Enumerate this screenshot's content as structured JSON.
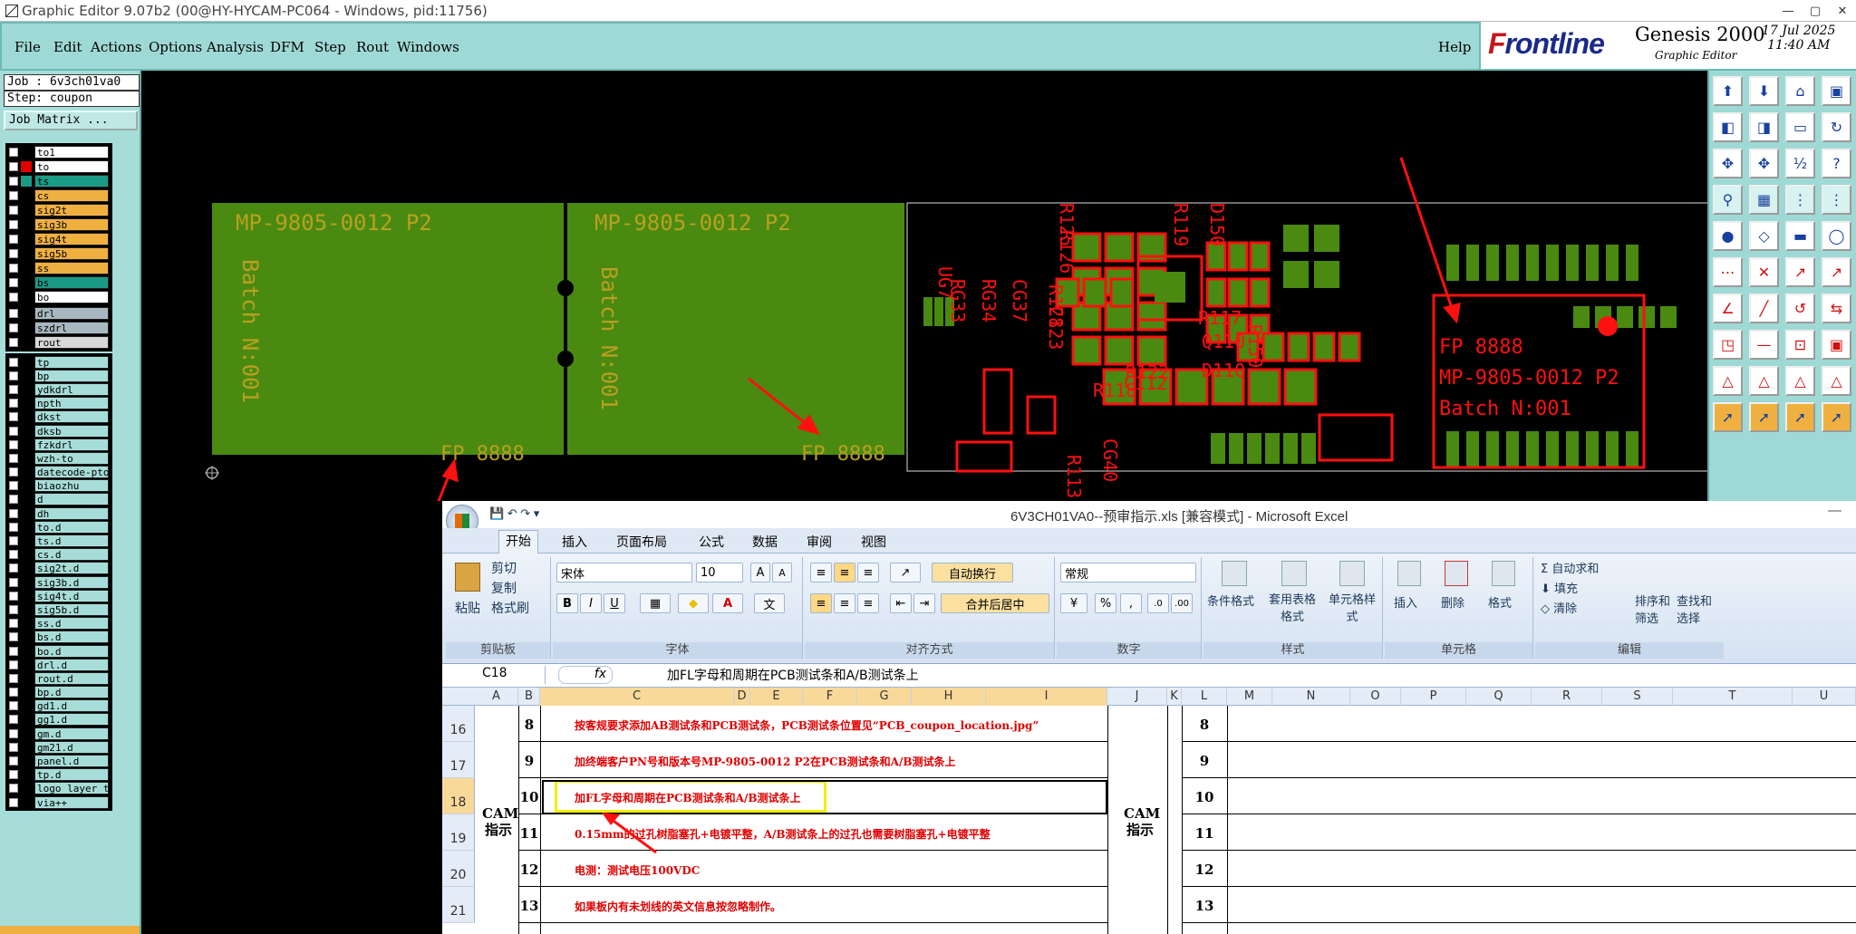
{
  "window": {
    "title": "Graphic Editor 9.07b2 (00@HY-HYCAM-PC064 - Windows, pid:11756)"
  },
  "menu": {
    "items": [
      "File",
      "Edit",
      "Actions",
      "Options",
      "Analysis",
      "DFM",
      "Step",
      "Rout",
      "Windows"
    ],
    "help": "Help"
  },
  "brand": {
    "logo_f": "F",
    "logo_rest": "rontline",
    "product": "Genesis 2000",
    "subtitle": "Graphic Editor",
    "date": "17 Jul 2025",
    "time": "11:40 AM"
  },
  "job": {
    "job_label": "Job : 6v3ch01va0",
    "step_label": "Step: coupon",
    "matrix_button": "Job Matrix ..."
  },
  "layers": {
    "group1": [
      {
        "name": "to1",
        "color": "#ffffff",
        "mark": "#000000"
      },
      {
        "name": "to",
        "color": "#ffffff",
        "mark": "#e00000"
      },
      {
        "name": "ts",
        "color": "#1b9a86",
        "mark": "#1b9a86"
      },
      {
        "name": "cs",
        "color": "#f0b040",
        "mark": "#000000"
      },
      {
        "name": "sig2t",
        "color": "#f0b040",
        "mark": "#000000"
      },
      {
        "name": "sig3b",
        "color": "#f0b040",
        "mark": "#000000"
      },
      {
        "name": "sig4t",
        "color": "#f0b040",
        "mark": "#000000"
      },
      {
        "name": "sig5b",
        "color": "#f0b040",
        "mark": "#000000"
      },
      {
        "name": "ss",
        "color": "#f0b040",
        "mark": "#000000"
      },
      {
        "name": "bs",
        "color": "#1b9a86",
        "mark": "#000000"
      },
      {
        "name": "bo",
        "color": "#ffffff",
        "mark": "#000000"
      }
    ],
    "group2": [
      {
        "name": "drl",
        "color": "#a8b8c0"
      },
      {
        "name": "szdrl",
        "color": "#a8b8c0"
      },
      {
        "name": "rout",
        "color": "#d8d8d8"
      }
    ],
    "group3": [
      "tp",
      "bp",
      "ydkdrl",
      "npth",
      "dkst",
      "dksb",
      "fzkdrl",
      "wzh-to",
      "datecode-pto",
      "biaozhu",
      "d",
      "dh",
      "to.d",
      "ts.d",
      "cs.d",
      "sig2t.d",
      "sig3b.d",
      "sig4t.d",
      "sig5b.d",
      "ss.d",
      "bs.d",
      "bo.d",
      "drl.d",
      "rout.d",
      "bp.d",
      "gd1.d",
      "gg1.d",
      "gm.d",
      "gm21.d",
      "panel.d",
      "tp.d",
      "logo_layer_t",
      "via++"
    ]
  },
  "board": {
    "part_number": "MP-9805-0012 P2",
    "batch": "Batch N:001",
    "fp": "FP 8888",
    "silk_labels": [
      "UG7",
      "RG33",
      "RG34",
      "CG37",
      "R128",
      "C123",
      "R125",
      "R126",
      "R119",
      "D150",
      "R117",
      "Q110",
      "D110",
      "R122",
      "R118",
      "C112",
      "CG40",
      "R113",
      "R150"
    ],
    "colors": {
      "green": "#4a8a10",
      "yellow": "#b9a020",
      "red": "#ff1010",
      "arrow": "#ff1010"
    }
  },
  "excel": {
    "title": "6V3CH01VA0--预审指示.xls [兼容模式] - Microsoft Excel",
    "tabs": [
      "开始",
      "插入",
      "页面布局",
      "公式",
      "数据",
      "审阅",
      "视图"
    ],
    "clipboard": {
      "paste": "粘贴",
      "cut": "剪切",
      "copy": "复制",
      "format_painter": "格式刷",
      "label": "剪贴板"
    },
    "font": {
      "name": "宋体",
      "size": "10",
      "bold": "B",
      "italic": "I",
      "underline": "U",
      "label": "字体"
    },
    "alignment": {
      "wrap": "自动换行",
      "merge": "合并后居中",
      "label": "对齐方式"
    },
    "number": {
      "format": "常规",
      "percent": "%",
      "comma": ",",
      "label": "数字"
    },
    "styles": {
      "conditional": "条件格式",
      "table": "套用表格格式",
      "cell": "单元格样式",
      "label": "样式"
    },
    "cells": {
      "insert": "插入",
      "delete": "删除",
      "format": "格式",
      "label": "单元格"
    },
    "editing": {
      "autosum": "自动求和",
      "fill": "填充",
      "clear": "清除",
      "sort": "排序和筛选",
      "find": "查找和选择",
      "label": "编辑"
    },
    "formula_bar": {
      "cell": "C18",
      "fx": "fx",
      "content": "加FL字母和周期在PCB测试条和A/B测试条上"
    },
    "columns": [
      "A",
      "B",
      "C",
      "D",
      "E",
      "F",
      "G",
      "H",
      "I",
      "J",
      "K",
      "L",
      "M",
      "N",
      "O",
      "P",
      "Q",
      "R",
      "S",
      "T",
      "U"
    ],
    "section_label": "CAM 指示",
    "rows": [
      {
        "row": "16",
        "num": "8",
        "text": "按客规要求添加AB测试条和PCB测试条，PCB测试条位置见“PCB_coupon_location.jpg”"
      },
      {
        "row": "17",
        "num": "9",
        "text": "加终端客户PN号和版本号MP-9805-0012  P2在PCB测试条和A/B测试条上"
      },
      {
        "row": "18",
        "num": "10",
        "text": "加FL字母和周期在PCB测试条和A/B测试条上"
      },
      {
        "row": "19",
        "num": "11",
        "text": "0.15mm的过孔树脂塞孔+电镀平整，A/B测试条上的过孔也需要树脂塞孔+电镀平整"
      },
      {
        "row": "20",
        "num": "12",
        "text": "电测：测试电压100VDC"
      },
      {
        "row": "21",
        "num": "13",
        "text": "如果板内有未划线的英文信息按忽略制作。"
      }
    ]
  }
}
